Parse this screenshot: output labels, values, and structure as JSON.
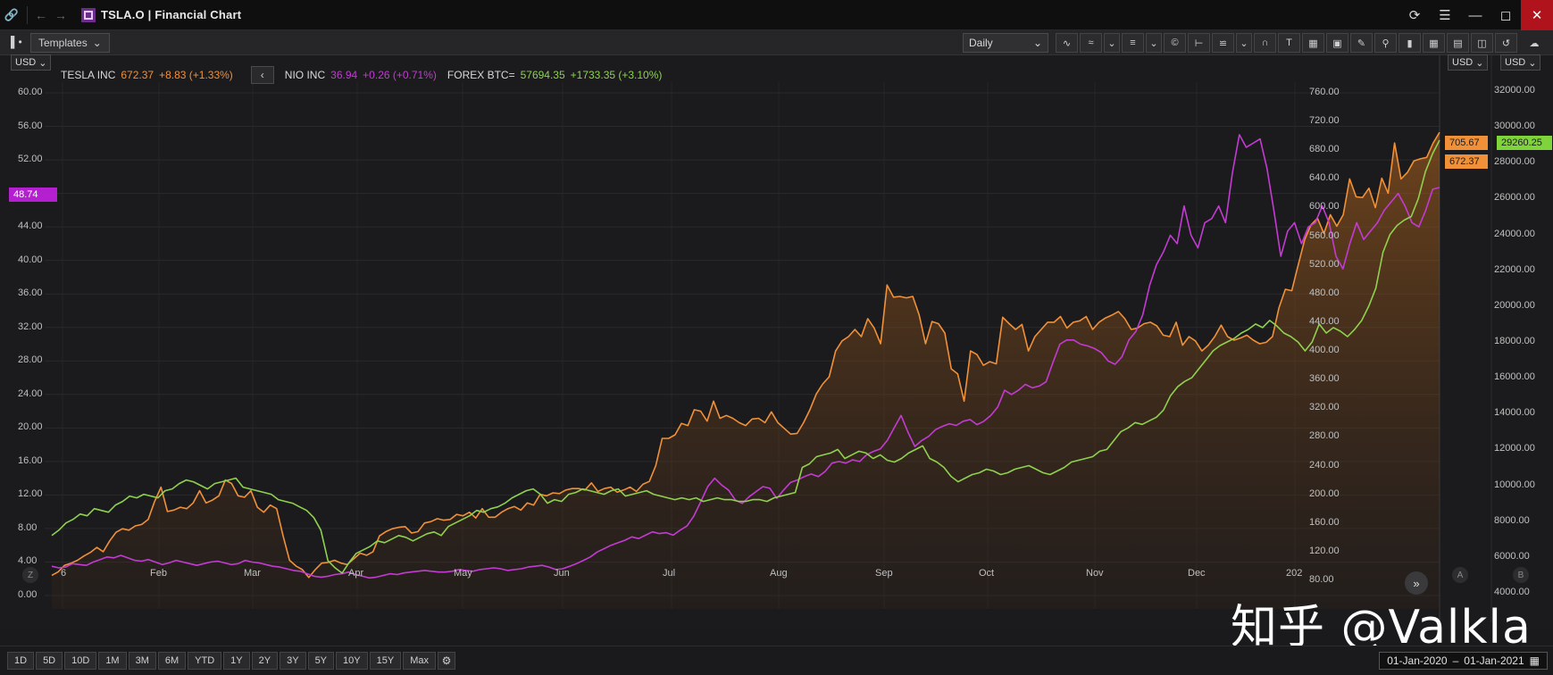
{
  "window": {
    "title": "TSLA.O | Financial Chart",
    "icons": [
      "link-icon",
      "back-arrow-icon",
      "forward-arrow-icon",
      "refresh-icon",
      "menu-icon",
      "minimize-icon",
      "maximize-icon",
      "close-icon"
    ]
  },
  "toolbar": {
    "templates_label": "Templates",
    "interval_label": "Daily",
    "tool_icons": [
      "line-chart-icon",
      "compare-icon",
      "list-icon",
      "currency-icon",
      "crosshair-icon",
      "fibonacci-icon",
      "magnet-icon",
      "text-icon",
      "shape-icon",
      "box-icon",
      "annotation-icon",
      "zoom-icon",
      "bar-chart-icon",
      "grid-icon",
      "panel-icon",
      "chart-settings-icon",
      "reset-icon",
      "cloud-icon"
    ]
  },
  "axes": {
    "left_currency": "USD",
    "mid_currency": "USD",
    "right_currency": "USD"
  },
  "legend": {
    "tsla": {
      "name": "TESLA INC",
      "price": "672.37",
      "change": "+8.83 (+1.33%)",
      "color": "#f0913a"
    },
    "nio": {
      "name": "NIO INC",
      "price": "36.94",
      "change": "+0.26 (+0.71%)",
      "color": "#c33bd3"
    },
    "btc": {
      "name": "FOREX BTC=",
      "price": "57694.35",
      "change": "+1733.35 (+3.10%)",
      "color": "#8fd14f"
    }
  },
  "price_tags": {
    "nio": "48.74",
    "tsla_high": "705.67",
    "tsla_last": "672.37",
    "btc": "29260.25"
  },
  "side_labels": {
    "a": "A",
    "b": "B",
    "z": "Z"
  },
  "watermark": "知乎 @Valkla",
  "bottom": {
    "ranges": [
      "1D",
      "5D",
      "10D",
      "1M",
      "3M",
      "6M",
      "YTD",
      "1Y",
      "2Y",
      "3Y",
      "5Y",
      "10Y",
      "15Y",
      "Max"
    ],
    "date_from": "01-Jan-2020",
    "date_sep": "–",
    "date_to": "01-Jan-2021"
  },
  "chart_data": {
    "type": "line",
    "x_labels": [
      "6",
      "Feb",
      "Mar",
      "Apr",
      "May",
      "Jun",
      "Jul",
      "Aug",
      "Sep",
      "Oct",
      "Nov",
      "Dec",
      "202"
    ],
    "left_axis": {
      "ticks": [
        "60.00",
        "56.00",
        "52.00",
        "48.00",
        "44.00",
        "40.00",
        "36.00",
        "32.00",
        "28.00",
        "24.00",
        "20.00",
        "16.00",
        "12.00",
        "8.00",
        "4.00",
        "0.00"
      ],
      "range": [
        0,
        60
      ]
    },
    "mid_axis": {
      "ticks": [
        "760.00",
        "720.00",
        "680.00",
        "640.00",
        "600.00",
        "560.00",
        "520.00",
        "480.00",
        "440.00",
        "400.00",
        "360.00",
        "320.00",
        "280.00",
        "240.00",
        "200.00",
        "160.00",
        "120.00",
        "80.00"
      ],
      "range": [
        80,
        760
      ]
    },
    "right_axis": {
      "ticks": [
        "32000.00",
        "30000.00",
        "28000.00",
        "26000.00",
        "24000.00",
        "22000.00",
        "20000.00",
        "18000.00",
        "16000.00",
        "14000.00",
        "12000.00",
        "10000.00",
        "8000.00",
        "6000.00",
        "4000.00"
      ],
      "range": [
        4000,
        32000
      ]
    },
    "series": [
      {
        "name": "TESLA INC",
        "axis": "mid",
        "color": "#f0913a",
        "fill": true,
        "values": [
          87,
          92,
          101,
          104,
          108,
          114,
          119,
          126,
          120,
          135,
          147,
          152,
          150,
          156,
          158,
          165,
          190,
          210,
          176,
          178,
          182,
          180,
          188,
          205,
          188,
          192,
          198,
          220,
          215,
          198,
          196,
          205,
          182,
          175,
          185,
          180,
          142,
          108,
          100,
          95,
          84,
          95,
          104,
          105,
          108,
          104,
          102,
          110,
          118,
          115,
          120,
          142,
          148,
          152,
          154,
          155,
          146,
          148,
          160,
          162,
          166,
          164,
          165,
          172,
          170,
          175,
          167,
          180,
          168,
          168,
          175,
          180,
          183,
          178,
          188,
          185,
          200,
          198,
          202,
          201,
          206,
          208,
          208,
          206,
          216,
          204,
          208,
          210,
          203,
          206,
          210,
          204,
          214,
          218,
          240,
          278,
          278,
          283,
          299,
          296,
          318,
          316,
          302,
          330,
          306,
          310,
          306,
          300,
          296,
          305,
          306,
          300,
          315,
          300,
          292,
          284,
          285,
          300,
          318,
          340,
          354,
          364,
          400,
          414,
          420,
          430,
          420,
          445,
          432,
          410,
          492,
          475,
          476,
          474,
          476,
          450,
          410,
          441,
          438,
          425,
          375,
          368,
          330,
          400,
          395,
          380,
          385,
          382,
          447,
          438,
          430,
          437,
          400,
          420,
          430,
          440,
          440,
          448,
          432,
          440,
          442,
          448,
          430,
          440,
          446,
          450,
          455,
          445,
          430,
          432,
          438,
          440,
          435,
          422,
          420,
          440,
          408,
          420,
          414,
          400,
          408,
          420,
          436,
          420,
          415,
          418,
          422,
          415,
          410,
          412,
          420,
          460,
          486,
          484,
          520,
          555,
          576,
          585,
          564,
          590,
          574,
          590,
          640,
          615,
          614,
          627,
          600,
          641,
          620,
          690,
          640,
          649,
          665,
          668,
          670,
          690,
          705
        ]
      },
      {
        "name": "NIO INC",
        "axis": "left",
        "color": "#c33bd3",
        "fill": false,
        "values": [
          3.5,
          3.3,
          3.4,
          3.8,
          3.7,
          3.6,
          4.0,
          4.3,
          4.6,
          4.5,
          4.8,
          4.5,
          4.2,
          4.1,
          4.3,
          4.0,
          3.7,
          3.9,
          4.2,
          4.0,
          3.8,
          3.6,
          3.8,
          4.0,
          4.1,
          3.9,
          3.7,
          3.8,
          4.2,
          4.0,
          3.9,
          3.7,
          3.5,
          3.4,
          3.2,
          3.0,
          2.9,
          2.6,
          2.3,
          2.2,
          2.3,
          2.5,
          2.6,
          2.8,
          2.5,
          2.3,
          2.1,
          2.2,
          2.4,
          2.6,
          2.5,
          2.7,
          2.8,
          2.9,
          3.0,
          2.9,
          2.8,
          2.8,
          2.9,
          3.1,
          3.0,
          2.9,
          3.1,
          3.2,
          3.3,
          3.2,
          3.0,
          3.1,
          3.2,
          3.4,
          3.5,
          3.6,
          3.4,
          3.1,
          3.2,
          3.5,
          3.8,
          4.2,
          4.6,
          5.2,
          5.6,
          6.0,
          6.3,
          6.6,
          7.0,
          6.8,
          7.2,
          7.6,
          7.4,
          7.5,
          7.2,
          7.8,
          8.3,
          9.5,
          11.2,
          13.0,
          14.0,
          13.2,
          12.6,
          11.4,
          11.0,
          11.8,
          12.4,
          13.0,
          12.8,
          11.6,
          12.6,
          13.5,
          13.8,
          14.2,
          14.5,
          14.2,
          14.8,
          15.8,
          16.0,
          15.8,
          16.2,
          16.0,
          16.8,
          17.2,
          17.5,
          18.5,
          20.0,
          21.5,
          19.5,
          17.8,
          18.5,
          19.0,
          19.8,
          20.2,
          20.5,
          20.3,
          20.8,
          21.0,
          20.4,
          20.8,
          21.5,
          22.5,
          24.5,
          24.0,
          24.5,
          25.2,
          24.8,
          25.0,
          25.5,
          27.8,
          30.0,
          30.5,
          30.5,
          30.0,
          29.8,
          29.5,
          29.0,
          28.0,
          27.6,
          28.5,
          30.5,
          31.5,
          33.5,
          37.0,
          39.5,
          41.0,
          43.0,
          42.0,
          46.5,
          43.0,
          41.5,
          44.5,
          45.0,
          46.5,
          44.5,
          50.5,
          55.0,
          53.5,
          54.0,
          54.5,
          51.0,
          46.0,
          40.5,
          43.5,
          44.5,
          42.0,
          44.0,
          44.5,
          46.5,
          44.5,
          40.5,
          39.0,
          42.0,
          44.5,
          42.5,
          43.5,
          44.5,
          46.0,
          47.0,
          48.0,
          46.5,
          44.5,
          44.0,
          46.0,
          48.5,
          48.7
        ]
      },
      {
        "name": "FOREX BTC=",
        "axis": "right",
        "color": "#8fd14f",
        "fill": false,
        "values": [
          7200,
          7500,
          7900,
          8100,
          8400,
          8300,
          8700,
          8600,
          8500,
          8900,
          9100,
          9400,
          9300,
          9500,
          9400,
          9300,
          9700,
          9800,
          10100,
          10300,
          10200,
          10000,
          9800,
          10100,
          10200,
          10300,
          10400,
          9900,
          9800,
          9700,
          9600,
          9500,
          9200,
          9100,
          9000,
          8800,
          8600,
          8200,
          7500,
          5800,
          5400,
          5100,
          5700,
          6200,
          6400,
          6600,
          6900,
          6800,
          7000,
          7200,
          7100,
          6900,
          7100,
          7300,
          7400,
          7200,
          7700,
          7900,
          8100,
          8300,
          8600,
          8500,
          8700,
          8800,
          9000,
          9300,
          9500,
          9700,
          9800,
          9500,
          9000,
          9200,
          9100,
          9500,
          9600,
          9800,
          9700,
          9600,
          9500,
          9700,
          9800,
          9400,
          9500,
          9600,
          9700,
          9500,
          9400,
          9300,
          9200,
          9300,
          9200,
          9300,
          9100,
          9200,
          9300,
          9200,
          9200,
          9100,
          9100,
          9200,
          9200,
          9100,
          9300,
          9400,
          9500,
          9600,
          11000,
          11200,
          11600,
          11700,
          11800,
          12000,
          11500,
          11700,
          11900,
          11800,
          11500,
          11700,
          11400,
          11300,
          11500,
          11800,
          12000,
          12200,
          11500,
          11300,
          11000,
          10500,
          10200,
          10400,
          10600,
          10700,
          10900,
          10800,
          10600,
          10700,
          10900,
          11000,
          11100,
          10900,
          10700,
          10600,
          10800,
          11000,
          11300,
          11400,
          11500,
          11600,
          11900,
          12000,
          12500,
          13000,
          13200,
          13500,
          13400,
          13600,
          13800,
          14200,
          15000,
          15500,
          15800,
          16000,
          16500,
          17000,
          17500,
          17800,
          18000,
          18200,
          18500,
          18700,
          19000,
          18800,
          19200,
          18900,
          18500,
          18300,
          18000,
          17500,
          18000,
          19000,
          18500,
          18800,
          18600,
          18300,
          18700,
          19200,
          20000,
          21000,
          23000,
          24000,
          24500,
          24800,
          25000,
          26000,
          27500,
          28500,
          29260
        ]
      }
    ]
  }
}
